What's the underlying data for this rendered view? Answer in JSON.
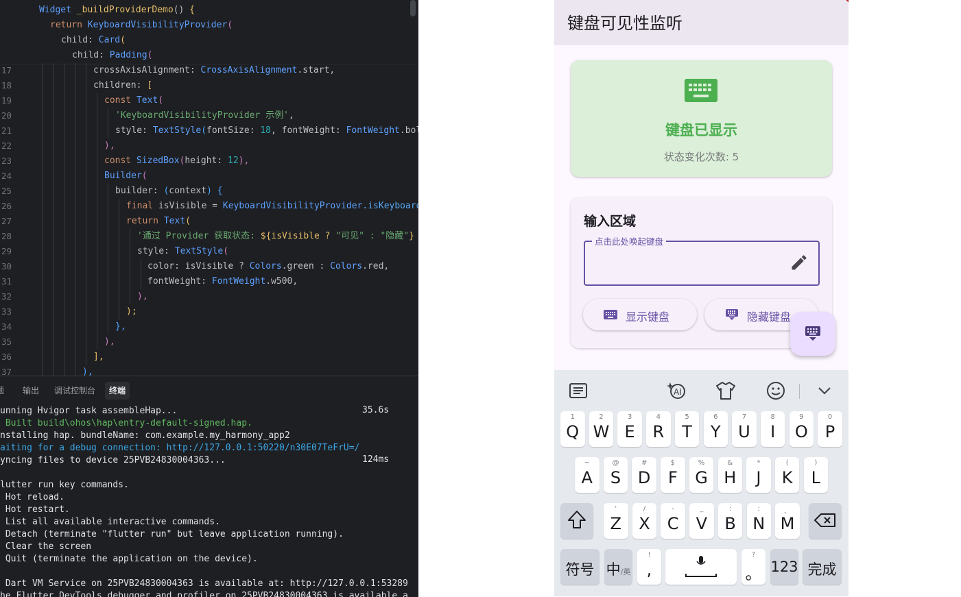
{
  "editor": {
    "lines": [
      {
        "num": "",
        "indent": 57,
        "parts": [
          [
            "Widget ",
            "ty"
          ],
          [
            "_buildProviderDemo",
            "b1"
          ],
          [
            "() ",
            "pr"
          ],
          [
            "{",
            "b1"
          ]
        ]
      },
      {
        "num": "",
        "indent": 73,
        "parts": [
          [
            "return ",
            "kw"
          ],
          [
            "KeyboardVisibilityProvider",
            "ty"
          ],
          [
            "(",
            "b2"
          ]
        ]
      },
      {
        "num": "",
        "indent": 89,
        "parts": [
          [
            "child: ",
            "pr"
          ],
          [
            "Card",
            "ty"
          ],
          [
            "(",
            "b1"
          ]
        ]
      },
      {
        "num": "",
        "indent": 105,
        "parts": [
          [
            "child: ",
            "pr"
          ],
          [
            "Padding",
            "ty"
          ],
          [
            "(",
            "b2"
          ]
        ]
      },
      {
        "num": "17",
        "indent": 136,
        "parts": [
          [
            "crossAxisAlignment: ",
            "pr"
          ],
          [
            "CrossAxisAlignment",
            "ty"
          ],
          [
            ".start,",
            "pr"
          ]
        ]
      },
      {
        "num": "18",
        "indent": 136,
        "parts": [
          [
            "children: ",
            "pr"
          ],
          [
            "[",
            "b1"
          ]
        ]
      },
      {
        "num": "19",
        "indent": 152,
        "parts": [
          [
            "const ",
            "kw"
          ],
          [
            "Text",
            "ty"
          ],
          [
            "(",
            "b2"
          ]
        ]
      },
      {
        "num": "20",
        "indent": 168,
        "parts": [
          [
            "'KeyboardVisibilityProvider 示例'",
            "st"
          ],
          [
            ",",
            "pr"
          ]
        ]
      },
      {
        "num": "21",
        "indent": 168,
        "parts": [
          [
            "style: ",
            "pr"
          ],
          [
            "TextStyle",
            "ty"
          ],
          [
            "(",
            "b3"
          ],
          [
            "fontSize: ",
            "pr"
          ],
          [
            "18",
            "nm"
          ],
          [
            ", fontWeight: ",
            "pr"
          ],
          [
            "FontWeight",
            "ty"
          ],
          [
            ".bol",
            "pr"
          ]
        ]
      },
      {
        "num": "22",
        "indent": 152,
        "parts": [
          [
            "),",
            "b2"
          ]
        ]
      },
      {
        "num": "23",
        "indent": 152,
        "parts": [
          [
            "const ",
            "kw"
          ],
          [
            "SizedBox",
            "ty"
          ],
          [
            "(",
            "b2"
          ],
          [
            "height: ",
            "pr"
          ],
          [
            "12",
            "nm"
          ],
          [
            "),",
            "b2"
          ]
        ]
      },
      {
        "num": "24",
        "indent": 152,
        "parts": [
          [
            "Builder",
            "ty"
          ],
          [
            "(",
            "b2"
          ]
        ]
      },
      {
        "num": "25",
        "indent": 168,
        "parts": [
          [
            "builder: ",
            "pr"
          ],
          [
            "(",
            "b3"
          ],
          [
            "context",
            "pr"
          ],
          [
            ") ",
            "b3"
          ],
          [
            "{",
            "b3"
          ]
        ]
      },
      {
        "num": "26",
        "indent": 184,
        "parts": [
          [
            "final ",
            "kw"
          ],
          [
            "isVisible = ",
            "pr"
          ],
          [
            "KeyboardVisibilityProvider",
            "ty"
          ],
          [
            ".isKeyboard",
            "fn"
          ]
        ]
      },
      {
        "num": "27",
        "indent": 184,
        "parts": [
          [
            "return ",
            "kw"
          ],
          [
            "Text",
            "ty"
          ],
          [
            "(",
            "b1"
          ]
        ]
      },
      {
        "num": "28",
        "indent": 200,
        "parts": [
          [
            "'通过 Provider 获取状态: ",
            "st"
          ],
          [
            "${",
            "b1"
          ],
          [
            "isVisible ? ",
            "b1"
          ],
          [
            "\"可见\" : \"隐藏\"",
            "st"
          ],
          [
            "}",
            "b1"
          ]
        ]
      },
      {
        "num": "29",
        "indent": 200,
        "parts": [
          [
            "style: ",
            "pr"
          ],
          [
            "TextStyle",
            "ty"
          ],
          [
            "(",
            "b2"
          ]
        ]
      },
      {
        "num": "30",
        "indent": 215,
        "parts": [
          [
            "color: isVisible ? ",
            "pr"
          ],
          [
            "Colors",
            "ty"
          ],
          [
            ".green : ",
            "pr"
          ],
          [
            "Colors",
            "ty"
          ],
          [
            ".red,",
            "pr"
          ]
        ]
      },
      {
        "num": "31",
        "indent": 215,
        "parts": [
          [
            "fontWeight: ",
            "pr"
          ],
          [
            "FontWeight",
            "ty"
          ],
          [
            ".w500,",
            "pr"
          ]
        ]
      },
      {
        "num": "32",
        "indent": 200,
        "parts": [
          [
            "),",
            "b2"
          ]
        ]
      },
      {
        "num": "33",
        "indent": 184,
        "parts": [
          [
            ");",
            "b1"
          ]
        ]
      },
      {
        "num": "34",
        "indent": 168,
        "parts": [
          [
            "},",
            "b3"
          ]
        ]
      },
      {
        "num": "35",
        "indent": 152,
        "parts": [
          [
            "),",
            "b2"
          ]
        ]
      },
      {
        "num": "36",
        "indent": 136,
        "parts": [
          [
            "],",
            "b1"
          ]
        ]
      },
      {
        "num": "37",
        "indent": 120,
        "parts": [
          [
            "),",
            "b3"
          ]
        ]
      }
    ]
  },
  "terminal": {
    "tabs": [
      {
        "label": "题",
        "active": false
      },
      {
        "label": "输出",
        "active": false
      },
      {
        "label": "调试控制台",
        "active": false
      },
      {
        "label": "终端",
        "active": true
      }
    ],
    "lines": [
      {
        "text": "unning Hvigor task assembleHap...",
        "time": "35.6s",
        "color": ""
      },
      {
        "text": " Built build\\ohos\\hap\\entry-default-signed.hap.",
        "time": "",
        "color": "g"
      },
      {
        "text": "nstalling hap. bundleName: com.example.my_harmony_app2",
        "time": "",
        "color": ""
      },
      {
        "text": "aiting for a debug connection: http://127.0.0.1:50220/n30E07TeFrU=/",
        "time": "",
        "color": "c"
      },
      {
        "text": "yncing files to device 25PVB24830004363...",
        "time": "124ms",
        "color": ""
      },
      {
        "text": "",
        "time": "",
        "color": ""
      },
      {
        "text": "lutter run key commands.",
        "time": "",
        "color": ""
      },
      {
        "text": " Hot reload.",
        "time": "",
        "color": ""
      },
      {
        "text": " Hot restart.",
        "time": "",
        "color": ""
      },
      {
        "text": " List all available interactive commands.",
        "time": "",
        "color": ""
      },
      {
        "text": " Detach (terminate \"flutter run\" but leave application running).",
        "time": "",
        "color": ""
      },
      {
        "text": " Clear the screen",
        "time": "",
        "color": ""
      },
      {
        "text": " Quit (terminate the application on the device).",
        "time": "",
        "color": ""
      },
      {
        "text": "",
        "time": "",
        "color": ""
      },
      {
        "text": " Dart VM Service on 25PVB24830004363 is available at: http://127.0.0.1:53289",
        "time": "",
        "color": ""
      },
      {
        "text": "he Flutter DevTools debugger and profiler on 25PVB24830004363 is available a",
        "time": "",
        "color": ""
      }
    ]
  },
  "app": {
    "title": "键盘可见性监听",
    "status_card": {
      "title": "键盘已显示",
      "count": "状态变化次数: 5",
      "color": "#4caf50"
    },
    "input_card": {
      "title": "输入区域",
      "field_label": "点击此处唤起键盘",
      "field_value": "",
      "show_button": "显示键盘",
      "hide_button": "隐藏键盘"
    },
    "accent": "#6750a4"
  },
  "keyboard": {
    "row1": [
      {
        "sub": "1",
        "main": "Q"
      },
      {
        "sub": "2",
        "main": "W"
      },
      {
        "sub": "3",
        "main": "E"
      },
      {
        "sub": "4",
        "main": "R"
      },
      {
        "sub": "5",
        "main": "T"
      },
      {
        "sub": "6",
        "main": "Y"
      },
      {
        "sub": "7",
        "main": "U"
      },
      {
        "sub": "8",
        "main": "I"
      },
      {
        "sub": "9",
        "main": "O"
      },
      {
        "sub": "0",
        "main": "P"
      }
    ],
    "row2": [
      {
        "sub": "~",
        "main": "A"
      },
      {
        "sub": "@",
        "main": "S"
      },
      {
        "sub": "#",
        "main": "D"
      },
      {
        "sub": "$",
        "main": "F"
      },
      {
        "sub": "%",
        "main": "G"
      },
      {
        "sub": "&",
        "main": "H"
      },
      {
        "sub": "*",
        "main": "J"
      },
      {
        "sub": "(",
        "main": "K"
      },
      {
        "sub": ")",
        "main": "L"
      }
    ],
    "row3": [
      {
        "sub": "'",
        "main": "Z"
      },
      {
        "sub": "/",
        "main": "X"
      },
      {
        "sub": "-",
        "main": "C"
      },
      {
        "sub": "_",
        "main": "V"
      },
      {
        "sub": ":",
        "main": "B"
      },
      {
        "sub": ";",
        "main": "N"
      },
      {
        "sub": "、",
        "main": "M"
      }
    ],
    "row4": {
      "symbols": "符号",
      "lang_main": "中",
      "lang_sub": "/英",
      "comma_sub": "!",
      "comma_main": ",",
      "period_sub": "?",
      "period_main": "。",
      "num": "123",
      "done": "完成"
    }
  }
}
